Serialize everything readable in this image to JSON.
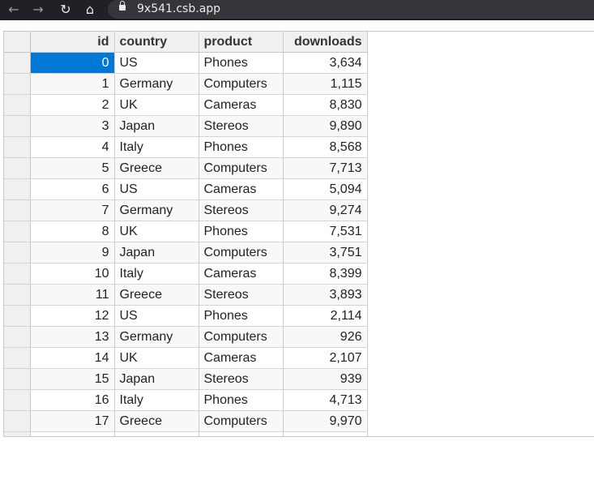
{
  "browser": {
    "url": "9x541.csb.app",
    "back_icon": "arrow-left-icon",
    "forward_icon": "arrow-right-icon",
    "reload_icon": "reload-icon",
    "home_icon": "home-icon",
    "lock_icon": "lock-icon"
  },
  "grid": {
    "columns": [
      "id",
      "country",
      "product",
      "downloads"
    ],
    "selected_cell": {
      "row": 0,
      "column": "id"
    },
    "selection_color": "#0078d4",
    "rows": [
      {
        "id": "0",
        "country": "US",
        "product": "Phones",
        "downloads": "3,634"
      },
      {
        "id": "1",
        "country": "Germany",
        "product": "Computers",
        "downloads": "1,115"
      },
      {
        "id": "2",
        "country": "UK",
        "product": "Cameras",
        "downloads": "8,830"
      },
      {
        "id": "3",
        "country": "Japan",
        "product": "Stereos",
        "downloads": "9,890"
      },
      {
        "id": "4",
        "country": "Italy",
        "product": "Phones",
        "downloads": "8,568"
      },
      {
        "id": "5",
        "country": "Greece",
        "product": "Computers",
        "downloads": "7,713"
      },
      {
        "id": "6",
        "country": "US",
        "product": "Cameras",
        "downloads": "5,094"
      },
      {
        "id": "7",
        "country": "Germany",
        "product": "Stereos",
        "downloads": "9,274"
      },
      {
        "id": "8",
        "country": "UK",
        "product": "Phones",
        "downloads": "7,531"
      },
      {
        "id": "9",
        "country": "Japan",
        "product": "Computers",
        "downloads": "3,751"
      },
      {
        "id": "10",
        "country": "Italy",
        "product": "Cameras",
        "downloads": "8,399"
      },
      {
        "id": "11",
        "country": "Greece",
        "product": "Stereos",
        "downloads": "3,893"
      },
      {
        "id": "12",
        "country": "US",
        "product": "Phones",
        "downloads": "2,114"
      },
      {
        "id": "13",
        "country": "Germany",
        "product": "Computers",
        "downloads": "926"
      },
      {
        "id": "14",
        "country": "UK",
        "product": "Cameras",
        "downloads": "2,107"
      },
      {
        "id": "15",
        "country": "Japan",
        "product": "Stereos",
        "downloads": "939"
      },
      {
        "id": "16",
        "country": "Italy",
        "product": "Phones",
        "downloads": "4,713"
      },
      {
        "id": "17",
        "country": "Greece",
        "product": "Computers",
        "downloads": "9,970"
      }
    ]
  }
}
